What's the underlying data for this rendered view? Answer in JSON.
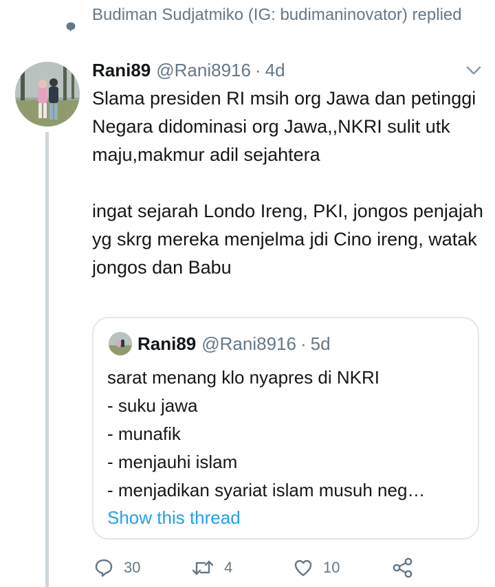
{
  "context": {
    "text": "Budiman Sudjatmiko (IG: budimaninovator) replied",
    "icon": "reply-bubble-icon"
  },
  "tweet": {
    "author_name": "Rani89",
    "author_handle": "@Rani8916",
    "separator": "·",
    "timestamp": "4d",
    "text": "Slama presiden RI msih org Jawa dan petinggi Negara didominasi org Jawa,,NKRI sulit utk maju,makmur adil sejahtera\n\ningat sejarah Londo Ireng, PKI, jongos penjajah yg skrg mereka menjelma jdi Cino ireng, watak jongos dan Babu"
  },
  "quote": {
    "author_name": "Rani89",
    "author_handle": "@Rani8916",
    "separator": "·",
    "timestamp": "5d",
    "text": "sarat menang klo nyapres di NKRI\n- suku jawa\n- munafik\n- menjauhi islam\n- menjadikan syariat islam musuh neg…",
    "show_thread_label": "Show this thread"
  },
  "actions": {
    "reply_count": "30",
    "retweet_count": "4",
    "like_count": "10"
  },
  "colors": {
    "secondary_text": "#657786",
    "link": "#1da1f2",
    "border": "#e1e8ed",
    "thread_line": "#ccd6dd"
  }
}
